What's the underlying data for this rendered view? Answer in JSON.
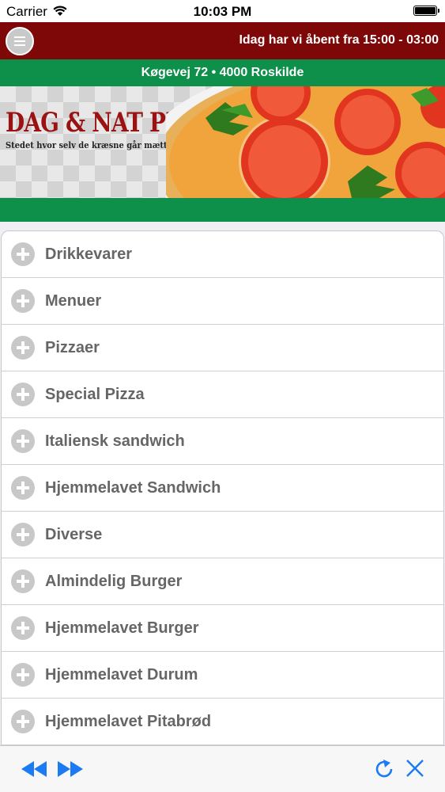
{
  "status_bar": {
    "carrier": "Carrier",
    "time": "10:03 PM"
  },
  "header": {
    "hours_text": "Idag har vi åbent fra 15:00 - 03:00"
  },
  "address": {
    "text": "Køgevej 72 • 4000 Roskilde"
  },
  "banner": {
    "title": "DAG & NAT PIZZA",
    "subtitle": "Stedet hvor selv de kræsne går mætte hjem"
  },
  "menu": {
    "items": [
      {
        "label": "Drikkevarer"
      },
      {
        "label": "Menuer"
      },
      {
        "label": "Pizzaer"
      },
      {
        "label": "Special Pizza"
      },
      {
        "label": "Italiensk sandwich"
      },
      {
        "label": "Hjemmelavet Sandwich"
      },
      {
        "label": "Diverse"
      },
      {
        "label": "Almindelig Burger"
      },
      {
        "label": "Hjemmelavet Burger"
      },
      {
        "label": "Hjemmelavet Durum"
      },
      {
        "label": "Hjemmelavet Pitabrød"
      }
    ]
  },
  "colors": {
    "brand_red": "#7e0808",
    "brand_green": "#0e8f4a",
    "toolbar_blue": "#1a7bf2"
  },
  "icons": [
    "menu-icon",
    "wifi-icon",
    "battery-icon",
    "plus-icon",
    "back-icon",
    "forward-icon",
    "reload-icon",
    "close-icon"
  ]
}
